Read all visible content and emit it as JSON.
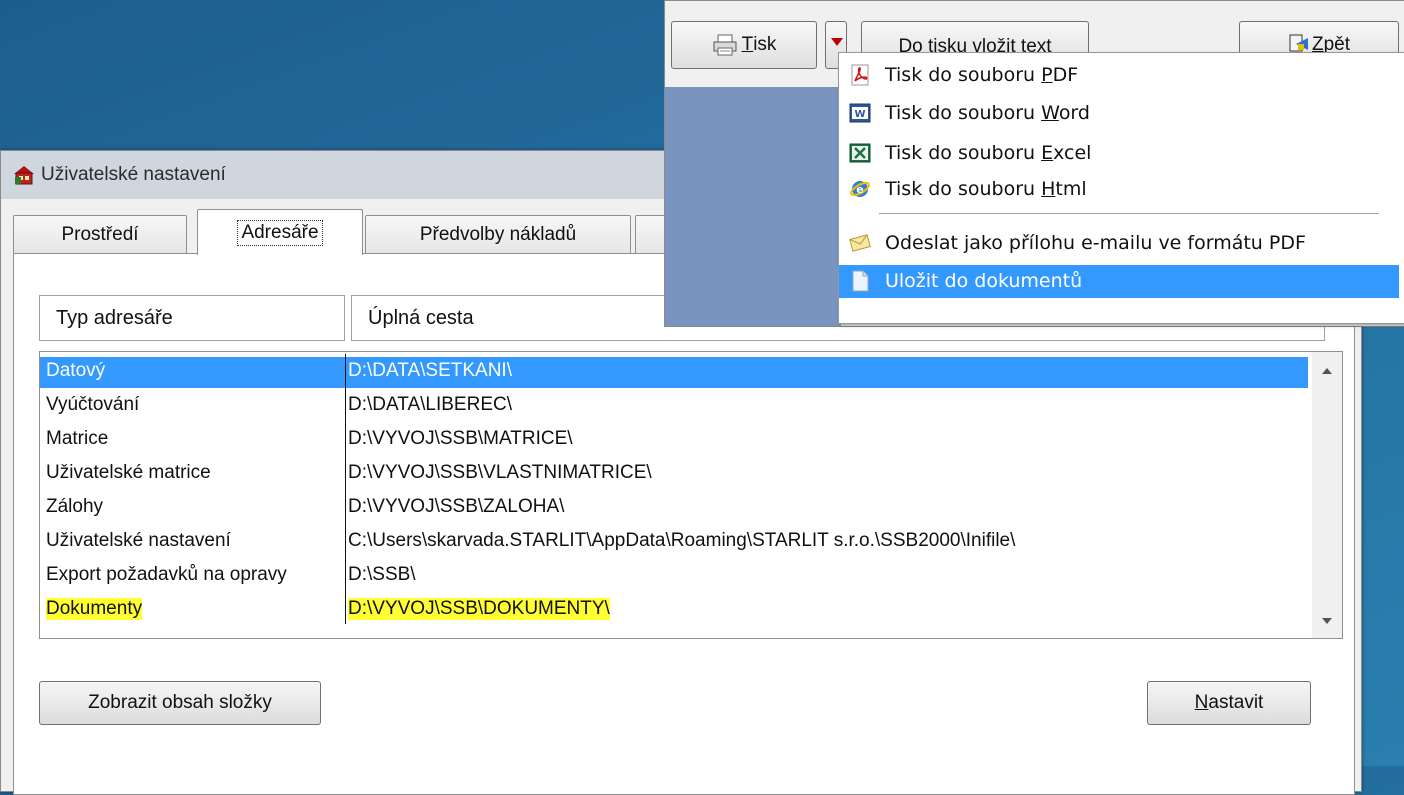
{
  "dialog": {
    "title": "Uživatelské nastavení",
    "tabs": [
      {
        "label": "Prostředí"
      },
      {
        "label": "Adresáře"
      },
      {
        "label": "Předvolby nákladů"
      },
      {
        "label": ""
      }
    ],
    "columns": [
      "Typ adresáře",
      "Úplná cesta"
    ],
    "rows": [
      {
        "type": "Datový",
        "path": "D:\\DATA\\SETKANI\\"
      },
      {
        "type": "Vyúčtování",
        "path": "D:\\DATA\\LIBEREC\\"
      },
      {
        "type": "Matrice",
        "path": "D:\\VYVOJ\\SSB\\MATRICE\\"
      },
      {
        "type": "Uživatelské matrice",
        "path": "D:\\VYVOJ\\SSB\\VLASTNIMATRICE\\"
      },
      {
        "type": "Zálohy",
        "path": "D:\\VYVOJ\\SSB\\ZALOHA\\"
      },
      {
        "type": "Uživatelské nastavení",
        "path": "C:\\Users\\skarvada.STARLIT\\AppData\\Roaming\\STARLIT s.r.o.\\SSB2000\\Inifile\\"
      },
      {
        "type": "Export požadavků na opravy",
        "path": "D:\\SSB\\"
      },
      {
        "type": "Dokumenty",
        "path": "D:\\VYVOJ\\SSB\\DOKUMENTY\\"
      }
    ],
    "buttons": {
      "show_folder": "Zobrazit obsah složky",
      "set_u": "N",
      "set_rest": "astavit"
    }
  },
  "print_window": {
    "print_u": "T",
    "print_rest": "isk",
    "insert_text": "Do tisku vložit text",
    "back_u": "Z",
    "back_rest": "pět"
  },
  "menu": {
    "items": [
      {
        "pre": "Tisk do souboru ",
        "u": "P",
        "post": "DF",
        "icon": "pdf-icon"
      },
      {
        "pre": "Tisk do souboru ",
        "u": "W",
        "post": "ord",
        "icon": "word-icon"
      },
      {
        "pre": "Tisk do souboru ",
        "u": "E",
        "post": "xcel",
        "icon": "excel-icon"
      },
      {
        "pre": "Tisk do souboru ",
        "u": "H",
        "post": "tml",
        "icon": "html-icon"
      },
      {
        "label": "Odeslat jako přílohu e-mailu ve formátu PDF",
        "icon": "envelope-icon"
      },
      {
        "label": "Uložit do dokumentů",
        "icon": "document-icon"
      }
    ]
  },
  "colors": {
    "selection": "#3399ff",
    "highlight": "#ffff33"
  }
}
